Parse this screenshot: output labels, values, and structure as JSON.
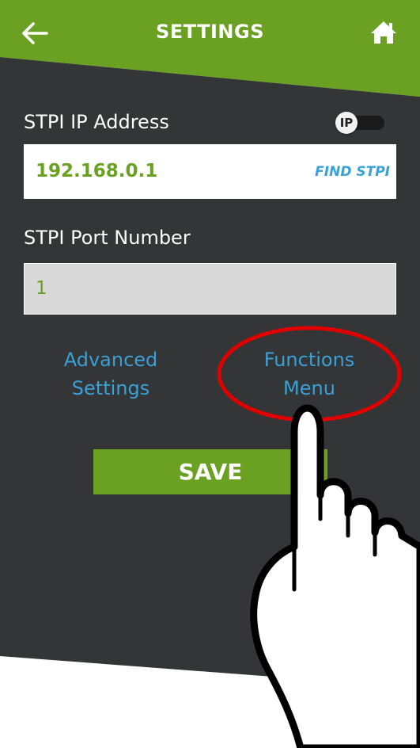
{
  "header": {
    "title": "SETTINGS",
    "back_icon": "arrow-left-icon",
    "home_icon": "home-icon"
  },
  "ip_address": {
    "label": "STPI IP Address",
    "toggle_label": "IP",
    "value": "192.168.0.1",
    "find_button": "FIND STPI"
  },
  "port": {
    "label": "STPI Port Number",
    "value": "1"
  },
  "links": {
    "advanced_line1": "Advanced",
    "advanced_line2": "Settings",
    "functions_line1": "Functions",
    "functions_line2": "Menu"
  },
  "save_label": "SAVE",
  "colors": {
    "brand_green": "#6aa122",
    "background_dark": "#333536",
    "link_blue": "#3aa0d8",
    "annotation_red": "#e00000"
  }
}
